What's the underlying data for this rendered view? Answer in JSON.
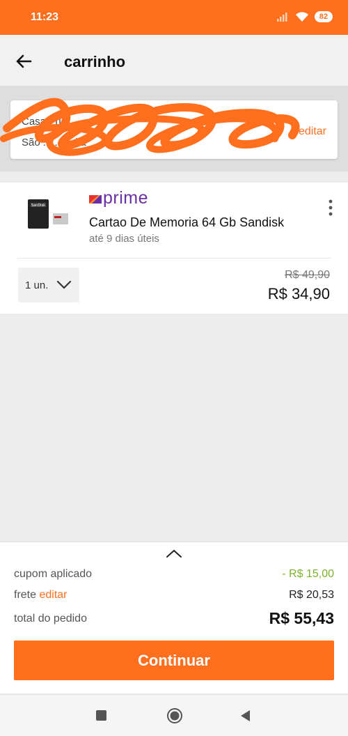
{
  "status_bar": {
    "time": "11:23",
    "battery": "82"
  },
  "header": {
    "title": "carrinho"
  },
  "address": {
    "line1": "Casa · rua ..........",
    "line2": "São ......... dia",
    "edit_label": "editar"
  },
  "product": {
    "badge": "prime",
    "name": "Cartao De Memoria 64 Gb Sandisk",
    "delivery": "até 9 dias úteis",
    "quantity": "1 un.",
    "old_price": "R$ 49,90",
    "price": "R$ 34,90"
  },
  "summary": {
    "coupon_label": "cupom aplicado",
    "coupon_value": "- R$ 15,00",
    "shipping_label": "frete",
    "shipping_edit": "editar",
    "shipping_value": "R$ 20,53",
    "total_label": "total do pedido",
    "total_value": "R$ 55,43",
    "continue_label": "Continuar"
  },
  "colors": {
    "brand": "#ff6f1e",
    "prime": "#6a2fa6",
    "coupon": "#7cb32c"
  },
  "icons": [
    "wifi-icon",
    "signal-icon",
    "back-arrow-icon",
    "more-vert-icon",
    "chevron-down-icon",
    "chevron-up-icon",
    "prime-logo-icon"
  ]
}
